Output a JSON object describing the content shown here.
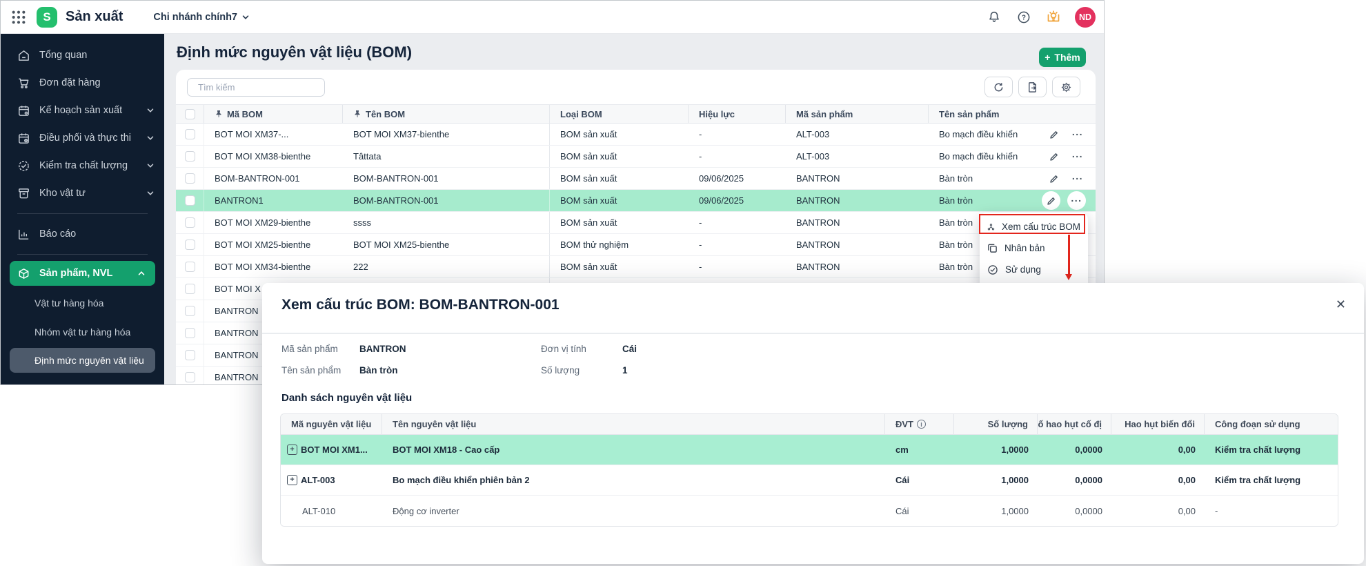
{
  "topbar": {
    "app_title": "Sản xuất",
    "branch_selector": "Chi nhánh chính7",
    "avatar_initials": "ND"
  },
  "sidebar": {
    "items": [
      {
        "label": "Tổng quan",
        "icon": "overview-icon",
        "chevron": false
      },
      {
        "label": "Đơn đặt hàng",
        "icon": "cart-icon",
        "chevron": false
      },
      {
        "label": "Kế hoạch sản xuất",
        "icon": "calendar-gear-icon",
        "chevron": true
      },
      {
        "label": "Điều phối và thực thi",
        "icon": "calendar-clock-icon",
        "chevron": true
      },
      {
        "label": "Kiểm tra chất lượng",
        "icon": "quality-check-icon",
        "chevron": true
      },
      {
        "label": "Kho vật tư",
        "icon": "warehouse-icon",
        "chevron": true
      }
    ],
    "reports_label": "Báo cáo",
    "products_group_label": "Sản phẩm, NVL",
    "submenu": [
      {
        "label": "Vật tư hàng hóa",
        "active": false
      },
      {
        "label": "Nhóm vật tư hàng hóa",
        "active": false
      },
      {
        "label": "Định mức nguyên vật liệu",
        "active": true
      }
    ]
  },
  "page": {
    "title": "Định mức nguyên vật liệu (BOM)",
    "add_plus": "+",
    "add_label": "Thêm",
    "search_placeholder": "Tìm kiếm"
  },
  "bom_table": {
    "headers": {
      "ma_bom": "Mã BOM",
      "ten_bom": "Tên BOM",
      "loai_bom": "Loại BOM",
      "hieu_luc": "Hiệu lực",
      "ma_san_pham": "Mã sản phẩm",
      "ten_san_pham": "Tên sản phẩm"
    },
    "rows": [
      {
        "ma_bom": "BOT MOI XM37-...",
        "ten_bom": "BOT MOI XM37-bienthe",
        "loai_bom": "BOM sản xuất",
        "hieu_luc": "-",
        "ma_san_pham": "ALT-003",
        "ten_san_pham": "Bo mạch điều khiển"
      },
      {
        "ma_bom": "BOT MOI XM38-bienthe",
        "ten_bom": "Tâttata",
        "loai_bom": "BOM sản xuất",
        "hieu_luc": "-",
        "ma_san_pham": "ALT-003",
        "ten_san_pham": "Bo mạch điều khiển"
      },
      {
        "ma_bom": "BOM-BANTRON-001",
        "ten_bom": "BOM-BANTRON-001",
        "loai_bom": "BOM sản xuất",
        "hieu_luc": "09/06/2025",
        "ma_san_pham": "BANTRON",
        "ten_san_pham": "Bàn tròn"
      },
      {
        "ma_bom": "BANTRON1",
        "ten_bom": "BOM-BANTRON-001",
        "loai_bom": "BOM sản xuất",
        "hieu_luc": "09/06/2025",
        "ma_san_pham": "BANTRON",
        "ten_san_pham": "Bàn tròn",
        "highlighted": true
      },
      {
        "ma_bom": "BOT MOI XM29-bienthe",
        "ten_bom": "ssss",
        "loai_bom": "BOM sản xuất",
        "hieu_luc": "-",
        "ma_san_pham": "BANTRON",
        "ten_san_pham": "Bàn tròn"
      },
      {
        "ma_bom": "BOT MOI XM25-bienthe",
        "ten_bom": "BOT MOI XM25-bienthe",
        "loai_bom": "BOM thử nghiệm",
        "hieu_luc": "-",
        "ma_san_pham": "BANTRON",
        "ten_san_pham": "Bàn tròn"
      },
      {
        "ma_bom": "BOT MOI XM34-bienthe",
        "ten_bom": "222",
        "loai_bom": "BOM sản xuất",
        "hieu_luc": "-",
        "ma_san_pham": "BANTRON",
        "ten_san_pham": "Bàn tròn"
      },
      {
        "ma_bom": "BOT MOI X",
        "partial": true
      },
      {
        "ma_bom": "BANTRON",
        "partial": true
      },
      {
        "ma_bom": "BANTRON",
        "partial": true
      },
      {
        "ma_bom": "BANTRON",
        "partial": true
      },
      {
        "ma_bom": "BANTRON",
        "partial": true
      }
    ]
  },
  "context_menu": {
    "items": [
      {
        "label": "Xem cấu trúc BOM",
        "icon": "bom-structure-icon",
        "annotated": true
      },
      {
        "label": "Nhân bản",
        "icon": "duplicate-icon"
      },
      {
        "label": "Sử dụng",
        "icon": "use-check-icon"
      }
    ]
  },
  "annotation": {
    "type": "red-box-and-arrow",
    "target": "Xem cấu trúc BOM"
  },
  "modal": {
    "title": "Xem cấu trúc BOM: BOM-BANTRON-001",
    "fields": {
      "ma_san_pham_label": "Mã sản phẩm",
      "ma_san_pham_value": "BANTRON",
      "ten_san_pham_label": "Tên sản phẩm",
      "ten_san_pham_value": "Bàn tròn",
      "don_vi_tinh_label": "Đơn vị tính",
      "don_vi_tinh_value": "Cái",
      "so_luong_label": "Số lượng",
      "so_luong_value": "1"
    },
    "section_title": "Danh sách nguyên vật liệu",
    "materials_table": {
      "headers": {
        "ma": "Mã nguyên vật liệu",
        "ten": "Tên nguyên vật liệu",
        "dvt": "ĐVT",
        "so_luong": "Số lượng",
        "hao_hut_co_dinh": "Số hao hụt cố đị",
        "hao_hut_bien_doi": "Hao hụt biến đổi",
        "cong_doan": "Công đoạn sử dụng"
      },
      "rows": [
        {
          "ma": "BOT MOI XM1...",
          "ten": "BOT MOI XM18 - Cao cấp",
          "dvt": "cm",
          "so_luong": "1,0000",
          "hao_hut_co_dinh": "0,0000",
          "hao_hut_bien_doi": "0,00",
          "cong_doan": "Kiểm tra chất lượng",
          "highlighted": true,
          "expandable": true
        },
        {
          "ma": "ALT-003",
          "ten": "Bo mạch điều khiển phiên bản 2",
          "dvt": "Cái",
          "so_luong": "1,0000",
          "hao_hut_co_dinh": "0,0000",
          "hao_hut_bien_doi": "0,00",
          "cong_doan": "Kiểm tra chất lượng",
          "expandable": true
        },
        {
          "ma": "ALT-010",
          "ten": "Động cơ inverter",
          "dvt": "Cái",
          "so_luong": "1,0000",
          "hao_hut_co_dinh": "0,0000",
          "hao_hut_bien_doi": "0,00",
          "cong_doan": "-",
          "expandable": false
        }
      ]
    }
  },
  "colors": {
    "primary_green": "#14a06d",
    "logo_green": "#24bf6d",
    "row_highlight": "#a6ebcd",
    "modal_row_highlight": "#a8eed2",
    "sidebar_bg": "#0f1d2f",
    "submenu_active_bg": "#4d5a6b",
    "annotation_red": "#e3261d",
    "avatar_bg": "#e3315e",
    "lamp_icon_orange": "#f0a43a",
    "main_bg": "#ebedf0"
  },
  "expander_glyph": "+"
}
